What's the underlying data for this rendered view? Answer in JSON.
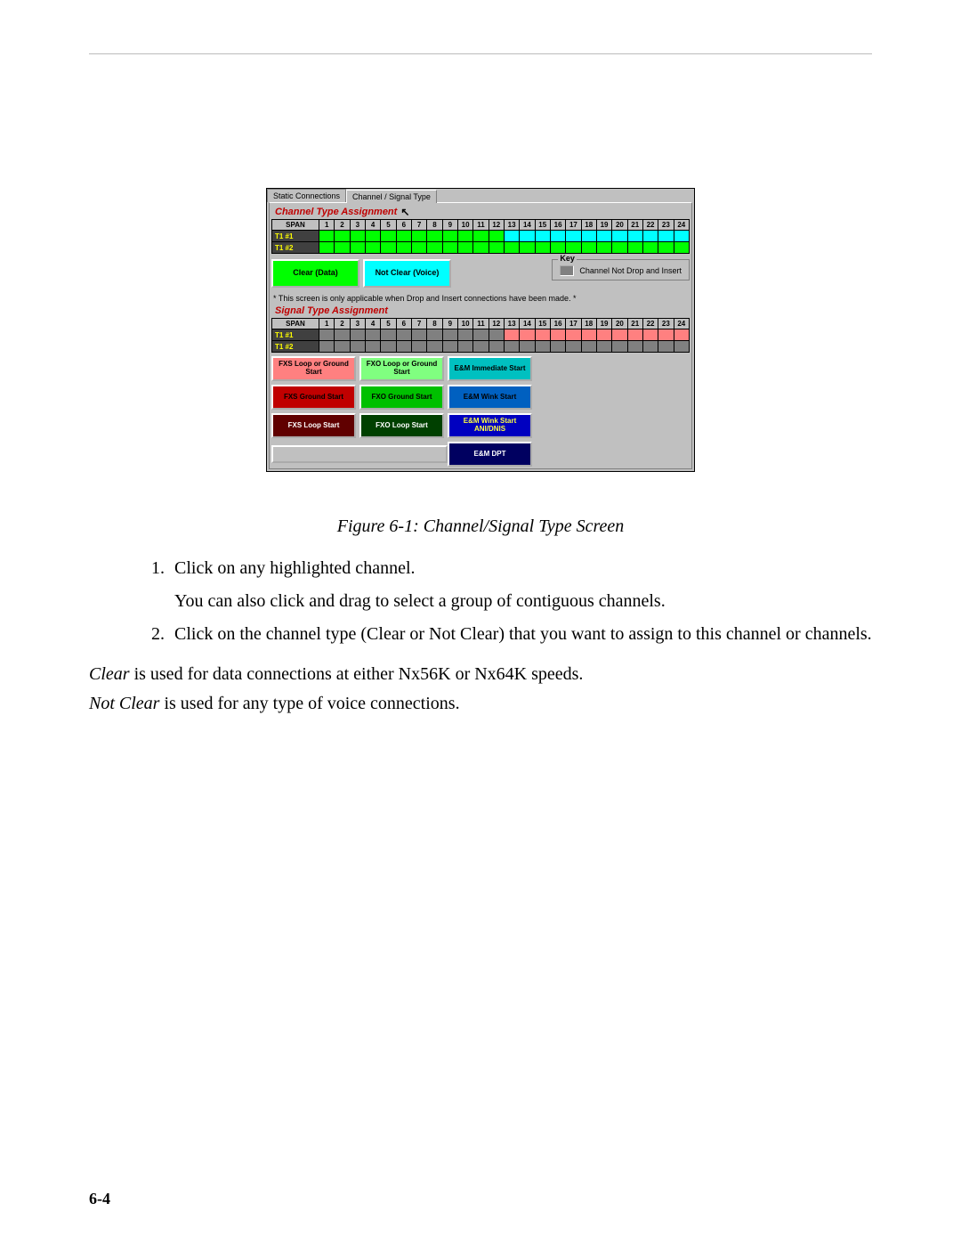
{
  "tabs": {
    "static": "Static Connections",
    "channel": "Channel / Signal Type"
  },
  "channel_section": {
    "title": "Channel Type Assignment",
    "span_header": "SPAN",
    "columns": [
      "1",
      "2",
      "3",
      "4",
      "5",
      "6",
      "7",
      "8",
      "9",
      "10",
      "11",
      "12",
      "13",
      "14",
      "15",
      "16",
      "17",
      "18",
      "19",
      "20",
      "21",
      "22",
      "23",
      "24"
    ],
    "rows": [
      "T1 #1",
      "T1 #2"
    ],
    "cells1": [
      "#00ff00",
      "#00ff00",
      "#00ff00",
      "#00ff00",
      "#00ff00",
      "#00ff00",
      "#00ff00",
      "#00ff00",
      "#00ff00",
      "#00ff00",
      "#00ff00",
      "#00ff00",
      "#00ffff",
      "#00ffff",
      "#00ffff",
      "#00ffff",
      "#00ffff",
      "#00ffff",
      "#00ffff",
      "#00ffff",
      "#00ffff",
      "#00ffff",
      "#00ffff",
      "#00ffff"
    ],
    "cells2": [
      "#00ff00",
      "#00ff00",
      "#00ff00",
      "#00ff00",
      "#00ff00",
      "#00ff00",
      "#00ff00",
      "#00ff00",
      "#00ff00",
      "#00ff00",
      "#00ff00",
      "#00ff00",
      "#00ff00",
      "#00ff00",
      "#00ff00",
      "#00ff00",
      "#00ff00",
      "#00ff00",
      "#00ff00",
      "#00ff00",
      "#00ff00",
      "#00ff00",
      "#00ff00",
      "#00ff00"
    ],
    "btn_clear": {
      "label": "Clear (Data)",
      "bg": "#00ff00",
      "fg": "#000000"
    },
    "btn_notclear": {
      "label": "Not Clear (Voice)",
      "bg": "#00ffff",
      "fg": "#000000"
    },
    "key_title": "Key",
    "key_item": "Channel Not Drop and Insert",
    "note": "* This screen is only applicable when Drop and Insert connections have been made. *"
  },
  "signal_section": {
    "title": "Signal Type Assignment",
    "span_header": "SPAN",
    "columns": [
      "1",
      "2",
      "3",
      "4",
      "5",
      "6",
      "7",
      "8",
      "9",
      "10",
      "11",
      "12",
      "13",
      "14",
      "15",
      "16",
      "17",
      "18",
      "19",
      "20",
      "21",
      "22",
      "23",
      "24"
    ],
    "rows": [
      "T1 #1",
      "T1 #2"
    ],
    "cells1": [
      "#808080",
      "#808080",
      "#808080",
      "#808080",
      "#808080",
      "#808080",
      "#808080",
      "#808080",
      "#808080",
      "#808080",
      "#808080",
      "#808080",
      "#ff8080",
      "#ff8080",
      "#ff8080",
      "#ff8080",
      "#ff8080",
      "#ff8080",
      "#ff8080",
      "#ff8080",
      "#ff8080",
      "#ff8080",
      "#ff8080",
      "#ff8080"
    ],
    "cells2": [
      "#808080",
      "#808080",
      "#808080",
      "#808080",
      "#808080",
      "#808080",
      "#808080",
      "#808080",
      "#808080",
      "#808080",
      "#808080",
      "#808080",
      "#808080",
      "#808080",
      "#808080",
      "#808080",
      "#808080",
      "#808080",
      "#808080",
      "#808080",
      "#808080",
      "#808080",
      "#808080",
      "#808080"
    ],
    "buttons": {
      "fxs_lg": {
        "label": "FXS Loop or Ground Start",
        "bg": "#ff8080",
        "fg": "#000000"
      },
      "fxs_g": {
        "label": "FXS Ground Start",
        "bg": "#c00000",
        "fg": "#000000"
      },
      "fxs_l": {
        "label": "FXS Loop Start",
        "bg": "#600000",
        "fg": "#ffffff"
      },
      "fxo_lg": {
        "label": "FXO Loop or Ground Start",
        "bg": "#80ff80",
        "fg": "#000000"
      },
      "fxo_g": {
        "label": "FXO Ground Start",
        "bg": "#00c000",
        "fg": "#000000"
      },
      "fxo_l": {
        "label": "FXO Loop Start",
        "bg": "#004000",
        "fg": "#ffffff"
      },
      "em_imm": {
        "label": "E&M Immediate Start",
        "bg": "#00c0c0",
        "fg": "#000000"
      },
      "em_wink": {
        "label": "E&M Wink Start",
        "bg": "#0060c0",
        "fg": "#000000"
      },
      "em_wad": {
        "label": "E&M Wink Start ANI/DNIS",
        "bg": "#0000c0",
        "fg": "#ffff40"
      },
      "em_dpt": {
        "label": "E&M DPT",
        "bg": "#000060",
        "fg": "#ffffff"
      }
    }
  },
  "doc": {
    "caption": "Figure 6-1: Channel/Signal Type Screen",
    "step1a": "Click on any highlighted channel.",
    "step1b": "You can also click and drag to select a group of contiguous channels.",
    "step2": "Click on the channel type (Clear or Not Clear) that you want to assign to this channel or channels.",
    "para1_i": "Clear",
    "para1_r": " is used for data connections at either Nx56K or Nx64K speeds.",
    "para2_i": "Not Clear",
    "para2_r": " is used for any type of voice connections.",
    "pagenum": "6-4"
  }
}
